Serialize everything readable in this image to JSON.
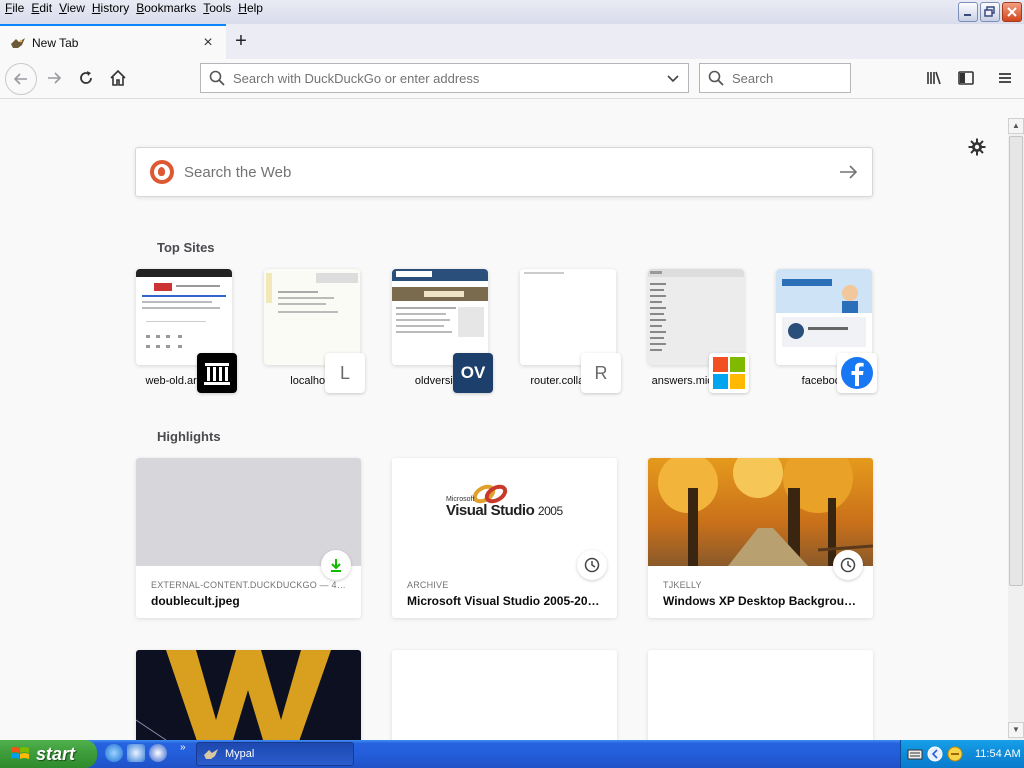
{
  "menubar": {
    "items": [
      "File",
      "Edit",
      "View",
      "History",
      "Bookmarks",
      "Tools",
      "Help"
    ]
  },
  "window": {
    "minimize_icon": "minimize-icon",
    "restore_icon": "restore-icon",
    "close_icon": "close-icon"
  },
  "tab": {
    "title": "New Tab",
    "close": "×",
    "new_tab": "+"
  },
  "navbar": {
    "url_placeholder": "Search with DuckDuckGo or enter address",
    "search_placeholder": "Search"
  },
  "content": {
    "web_search_placeholder": "Search the Web",
    "top_sites_title": "Top Sites",
    "highlights_title": "Highlights"
  },
  "top_sites": [
    {
      "label": "web-old.archive",
      "icon_text": ""
    },
    {
      "label": "localhost",
      "icon_text": "L"
    },
    {
      "label": "oldversion",
      "icon_text": "OV"
    },
    {
      "label": "router.collabnet",
      "icon_text": "R"
    },
    {
      "label": "answers.microsoft",
      "icon_text": ""
    },
    {
      "label": "facebook",
      "icon_text": ""
    }
  ],
  "highlights": [
    {
      "source": "EXTERNAL-CONTENT.DUCKDUCKGO — 4…",
      "title": "doublecult.jpeg",
      "badge": "download-icon"
    },
    {
      "source": "ARCHIVE",
      "title": "Microsoft Visual Studio 2005-20…",
      "badge": "clock-icon",
      "thumb_text_small": "Microsoft",
      "thumb_text": "Visual Studio",
      "thumb_year": "2005"
    },
    {
      "source": "TJKELLY",
      "title": "Windows XP Desktop Backgrou…",
      "badge": "clock-icon"
    }
  ],
  "taskbar": {
    "start_label": "start",
    "task_label": "Mypal",
    "clock": "11:54 AM"
  },
  "colors": {
    "accent": "#0a84ff",
    "ddg": "#de5833",
    "taskbar": "#245edb",
    "start": "#3c9b3a"
  }
}
